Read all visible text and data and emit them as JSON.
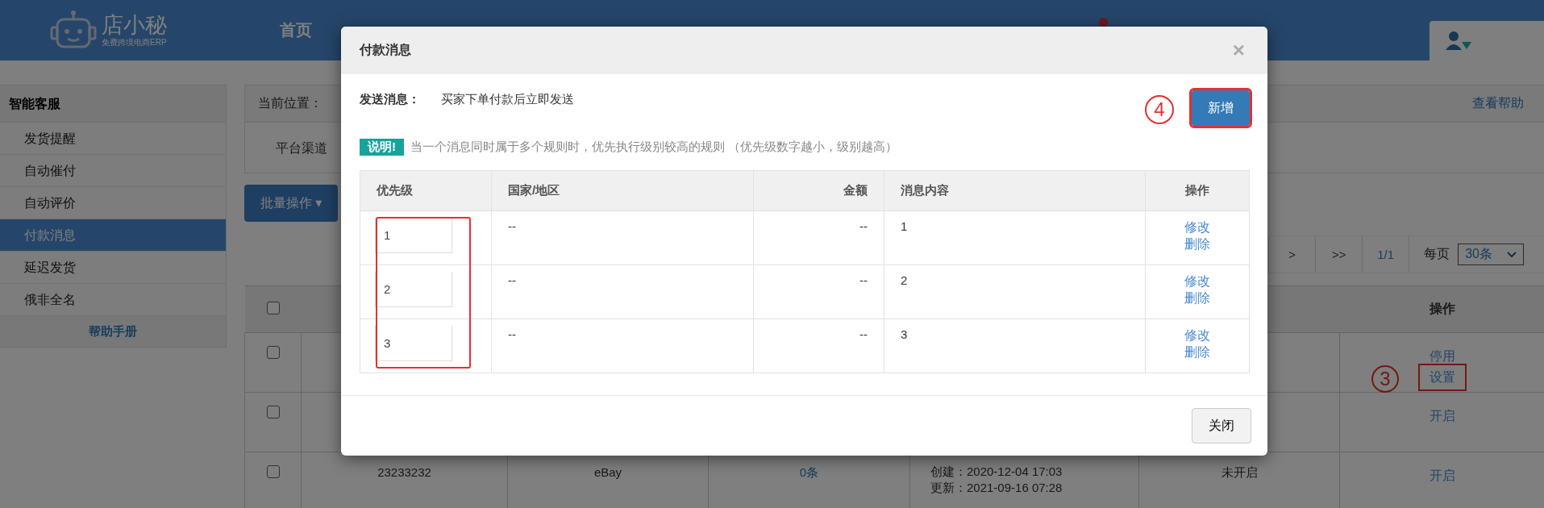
{
  "header": {
    "logo_text": "店小秘",
    "logo_subtitle": "免费跨境电商ERP",
    "nav": [
      {
        "label": "首页"
      }
    ],
    "notification": true
  },
  "sidebar": {
    "title": "智能客服",
    "items": [
      {
        "label": "发货提醒",
        "selected": false
      },
      {
        "label": "自动催付",
        "selected": false
      },
      {
        "label": "自动评价",
        "selected": false
      },
      {
        "label": "付款消息",
        "selected": true
      },
      {
        "label": "延迟发货",
        "selected": false
      },
      {
        "label": "俄非全名",
        "selected": false
      }
    ],
    "help_link": "帮助手册"
  },
  "breadcrumb": {
    "label": "当前位置：",
    "help_link": "查看帮助"
  },
  "filter": {
    "label": "平台渠道"
  },
  "batch_button": {
    "label": "批量操作",
    "caret": "▾"
  },
  "pagination": {
    "buttons": [
      ">",
      ">>",
      "1/1"
    ],
    "per_page_label": "每页",
    "per_page_value": "30条"
  },
  "table": {
    "header_checked": false,
    "header_action": "操作",
    "rows": [
      {
        "checked": false,
        "cells": [],
        "actions": [
          {
            "label": "停用",
            "highlighted": false
          },
          {
            "label": "设置",
            "highlighted": true
          }
        ],
        "annotation": "3"
      },
      {
        "checked": false,
        "cells": [],
        "actions": [
          {
            "label": "开启",
            "highlighted": false
          }
        ]
      },
      {
        "checked": false,
        "cells": [
          "23233232",
          "eBay",
          "0条",
          [
            "创建：2020-12-04 17:03",
            "更新：2021-09-16 07:28"
          ],
          "未开启"
        ],
        "actions": [
          {
            "label": "开启",
            "highlighted": false
          }
        ]
      }
    ]
  },
  "modal": {
    "title": "付款消息",
    "close": "×",
    "send_label": "发送消息：",
    "send_value": "买家下单付款后立即发送",
    "add_button": {
      "label": "新增",
      "highlighted": true,
      "annotation": "4"
    },
    "notice": {
      "badge": "说明!",
      "text": "当一个消息同时属于多个规则时，优先执行级别较高的规则 （优先级数字越小，级别越高）"
    },
    "columns": [
      "优先级",
      "国家/地区",
      "金额",
      "消息内容",
      "操作"
    ],
    "priority_highlighted": true,
    "rows": [
      {
        "priority": "1",
        "country": "--",
        "amount": "--",
        "content": "1",
        "actions": [
          "修改",
          "删除"
        ]
      },
      {
        "priority": "2",
        "country": "--",
        "amount": "--",
        "content": "2",
        "actions": [
          "修改",
          "删除"
        ]
      },
      {
        "priority": "3",
        "country": "--",
        "amount": "--",
        "content": "3",
        "actions": [
          "修改",
          "删除"
        ]
      }
    ],
    "footer_button": "关闭"
  }
}
